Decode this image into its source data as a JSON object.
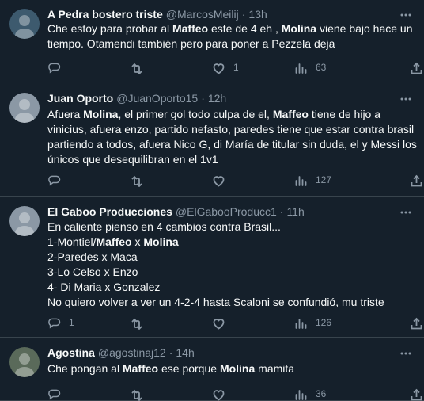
{
  "tweets": [
    {
      "name": "A Pedra bostero triste",
      "handle": "@MarcosMeilij",
      "time": "13h",
      "lines": [
        [
          {
            "t": "Che estoy para probar al "
          },
          {
            "t": "Maffeo",
            "b": true
          },
          {
            "t": " este de 4 eh , "
          },
          {
            "t": "Molina",
            "b": true
          },
          {
            "t": " viene bajo hace un"
          }
        ],
        [
          {
            "t": "tiempo. Otamendi también pero para poner a Pezzela deja"
          }
        ]
      ],
      "replies": "",
      "retweets": "",
      "likes": "1",
      "views": "63",
      "avatar_color": "#3d5a6e"
    },
    {
      "name": "Juan Oporto",
      "handle": "@JuanOporto15",
      "time": "12h",
      "lines": [
        [
          {
            "t": "Afuera "
          },
          {
            "t": "Molina",
            "b": true
          },
          {
            "t": ", el primer gol todo culpa de el, "
          },
          {
            "t": "Maffeo",
            "b": true
          },
          {
            "t": " tiene de hijo a"
          }
        ],
        [
          {
            "t": "vinicius, afuera enzo, partido nefasto, paredes tiene que estar contra brasil"
          }
        ],
        [
          {
            "t": "partiendo a todos, afuera Nico G, di María de titular sin duda, el y Messi los"
          }
        ],
        [
          {
            "t": "únicos que desequilibran en el 1v1"
          }
        ]
      ],
      "replies": "",
      "retweets": "",
      "likes": "",
      "views": "127",
      "avatar_color": "#8b98a5"
    },
    {
      "name": "El Gaboo Producciones",
      "handle": "@ElGabooProducc1",
      "time": "11h",
      "lines": [
        [
          {
            "t": "En caliente pienso en 4 cambios contra Brasil..."
          }
        ],
        [
          {
            "t": "1-Montiel/"
          },
          {
            "t": "Maffeo",
            "b": true
          },
          {
            "t": " x "
          },
          {
            "t": "Molina",
            "b": true
          }
        ],
        [
          {
            "t": "2-Paredes x Maca"
          }
        ],
        [
          {
            "t": "3-Lo Celso x Enzo"
          }
        ],
        [
          {
            "t": "4- Di Maria x Gonzalez"
          }
        ],
        [
          {
            "t": "No quiero volver a ver un 4-2-4 hasta Scaloni se confundió, mu triste"
          }
        ]
      ],
      "replies": "1",
      "retweets": "",
      "likes": "",
      "views": "126",
      "avatar_color": "#8b98a5"
    },
    {
      "name": "Agostina",
      "handle": "@agostinaj12",
      "time": "14h",
      "lines": [
        [
          {
            "t": "Che pongan al "
          },
          {
            "t": "Maffeo",
            "b": true
          },
          {
            "t": " ese porque "
          },
          {
            "t": "Molina",
            "b": true
          },
          {
            "t": " mamita"
          }
        ]
      ],
      "replies": "",
      "retweets": "",
      "likes": "",
      "views": "36",
      "avatar_color": "#5a6a5a"
    }
  ],
  "icons": {
    "reply": "reply-icon",
    "retweet": "retweet-icon",
    "like": "heart-icon",
    "views": "views-icon",
    "share": "share-icon",
    "more": "more-icon"
  },
  "colors": {
    "background": "#15202b",
    "text": "#f7f9f9",
    "secondary": "#8b98a5",
    "divider": "#38444d"
  }
}
